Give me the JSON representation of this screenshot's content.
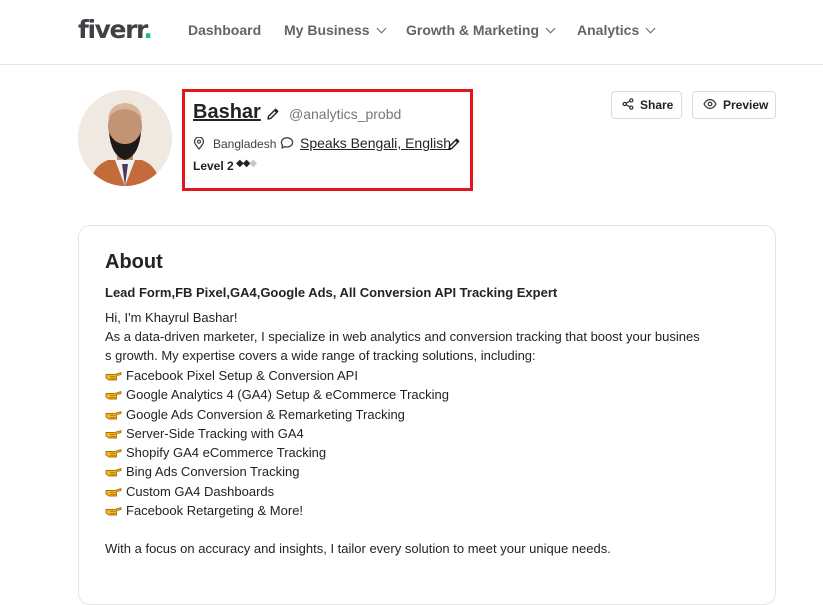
{
  "header": {
    "logo_text": "fiverr",
    "logo_dot": ".",
    "nav": [
      {
        "label": "Dashboard",
        "has_dropdown": false
      },
      {
        "label": "My Business",
        "has_dropdown": true
      },
      {
        "label": "Growth & Marketing",
        "has_dropdown": true
      },
      {
        "label": "Analytics",
        "has_dropdown": true
      }
    ]
  },
  "profile": {
    "name": "Bashar",
    "username": "@analytics_probd",
    "country": "Bangladesh",
    "languages": "Speaks Bengali, English",
    "level_label": "Level 2",
    "level_filled": 2,
    "level_total": 3,
    "share_label": "Share",
    "preview_label": "Preview",
    "highlight_color": "#e3141b"
  },
  "about": {
    "title": "About",
    "tagline": "Lead Form,FB Pixel,GA4,Google Ads, All Conversion API Tracking Expert",
    "greeting": "Hi, I'm Khayrul Bashar!",
    "intro_line1": "As a data-driven marketer, I specialize in web analytics and conversion tracking that boost your busines",
    "intro_line2": "s growth. My expertise covers a wide range of tracking solutions, including:",
    "bullets": [
      "Facebook Pixel Setup & Conversion API",
      "Google Analytics 4 (GA4) Setup & eCommerce Tracking",
      "Google Ads Conversion & Remarketing Tracking",
      "Server-Side Tracking with GA4",
      "Shopify GA4 eCommerce Tracking",
      "Bing Ads Conversion Tracking",
      "Custom GA4 Dashboards",
      "Facebook Retargeting & More!"
    ],
    "closing": "With a focus on accuracy and insights, I tailor every solution to meet your unique needs."
  }
}
